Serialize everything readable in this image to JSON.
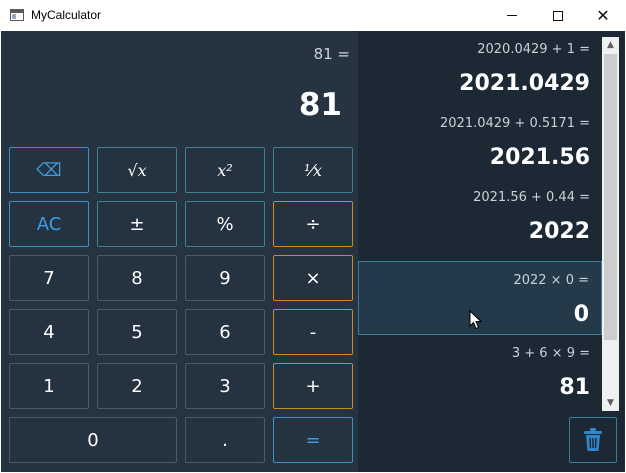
{
  "window": {
    "title": "MyCalculator"
  },
  "display": {
    "expression": "81 =",
    "result": "81"
  },
  "keypad": {
    "backspace": "⌫",
    "sqrt": "√x",
    "square": "x²",
    "reciprocal": "¹⁄x",
    "clear": "AC",
    "negate": "±",
    "percent": "%",
    "divide": "÷",
    "seven": "7",
    "eight": "8",
    "nine": "9",
    "multiply": "×",
    "four": "4",
    "five": "5",
    "six": "6",
    "subtract": "-",
    "one": "1",
    "two": "2",
    "three": "3",
    "add": "+",
    "zero": "0",
    "decimal": ".",
    "equals": "="
  },
  "history": [
    {
      "expression": "2020.0429 + 1 =",
      "result": "2021.0429"
    },
    {
      "expression": "2021.0429 + 0.5171 =",
      "result": "2021.56"
    },
    {
      "expression": "2021.56 + 0.44 =",
      "result": "2022"
    },
    {
      "expression": "2022 × 0 =",
      "result": "0"
    },
    {
      "expression": "3 + 6 × 9 =",
      "result": "81"
    }
  ],
  "icons": {
    "trash": "trash-icon",
    "app": "calculator-app-icon"
  },
  "colors": {
    "accent_blue": "#3d9ce0",
    "operator_orange": "#c88a2c",
    "function_teal": "#3f8090",
    "background": "#263340"
  }
}
